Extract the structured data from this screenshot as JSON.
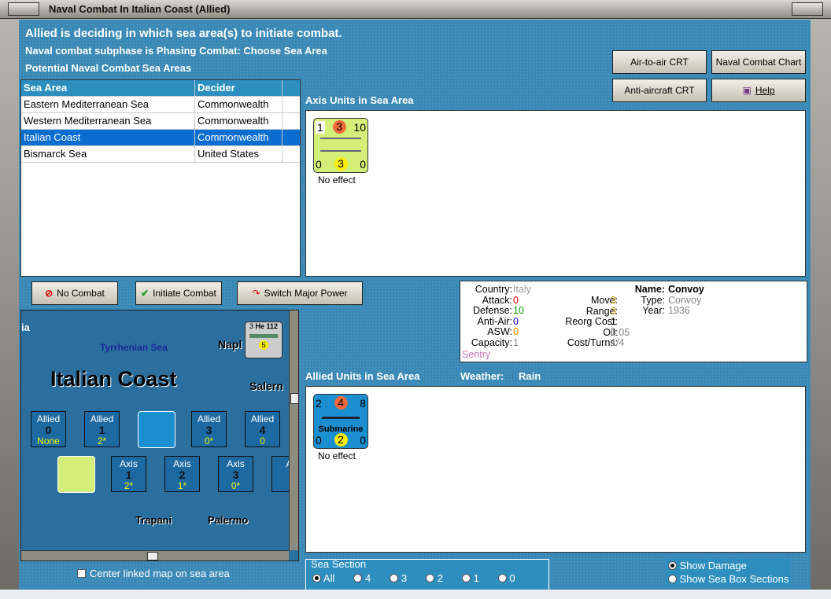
{
  "window": {
    "title": "Naval Combat In Italian Coast (Allied)"
  },
  "header": {
    "line1": "Allied is deciding in which sea area(s) to initiate combat.",
    "line2": "Naval combat subphase is Phasing Combat: Choose Sea Area",
    "line3": "Potential Naval Combat Sea Areas"
  },
  "buttons": {
    "air_crt": "Air-to-air CRT",
    "naval_chart": "Naval Combat Chart",
    "aa_crt": "Anti-aircraft CRT",
    "help": "Help",
    "no_combat": "No Combat",
    "initiate": "Initiate Combat",
    "switch": "Switch Major Power"
  },
  "table": {
    "headers": [
      "Sea Area",
      "Decider"
    ],
    "rows": [
      [
        "Eastern Mediterranean Sea",
        "Commonwealth"
      ],
      [
        "Western Mediterranean Sea",
        "Commonwealth"
      ],
      [
        "Italian Coast",
        "Commonwealth"
      ],
      [
        "Bismarck Sea",
        "United States"
      ]
    ],
    "selected": 2
  },
  "axis": {
    "label": "Axis Units in Sea Area",
    "unit": {
      "tl": "1",
      "tm": "3",
      "tr": "10",
      "bl": "0",
      "bm": "3",
      "br": "0",
      "status": "No effect"
    }
  },
  "allied": {
    "label": "Allied Units in Sea Area",
    "weather_label": "Weather:",
    "weather": "Rain",
    "unit": {
      "tl": "2",
      "tm": "4",
      "tr": "8",
      "name": "Submarine",
      "bl": "0",
      "bm": "2",
      "br": "0",
      "status": "No effect"
    }
  },
  "info": {
    "country_l": "Country:",
    "country": "Italy",
    "attack_l": "Attack:",
    "attack": "0",
    "defense_l": "Defense:",
    "defense": "10",
    "aa_l": "Anti-Air:",
    "aa": "0",
    "asw_l": "ASW:",
    "asw": "0",
    "capacity_l": "Capacity:",
    "capacity": "1",
    "sentry": "Sentry",
    "name_l": "Name:",
    "name": "Convoy",
    "move_l": "Move:",
    "move": "3",
    "type_l": "Type:",
    "type": "Convoy",
    "range_l": "Range:",
    "range": "3",
    "year_l": "Year:",
    "year": "1936",
    "reorg_l": "Reorg Cost:",
    "reorg": "1",
    "oil_l": "Oil:",
    "oil": "0.05",
    "cost_l": "Cost/Turns:",
    "cost": "1/4"
  },
  "map": {
    "title": "Italian Coast",
    "sea": "Tyrrhenian Sea",
    "cities": [
      "Napl",
      "Salern",
      "Trapani",
      "Palermo",
      "ia"
    ],
    "air_unit": {
      "a": "3",
      "name": "He 112",
      "b": "5"
    },
    "allied_boxes": [
      {
        "label": "Allied",
        "n": "0",
        "v": "None"
      },
      {
        "label": "Allied",
        "n": "1",
        "v": "2*"
      },
      {
        "label": "Allied",
        "n": "3",
        "v": "0*"
      },
      {
        "label": "Allied",
        "n": "4",
        "v": "0"
      }
    ],
    "axis_boxes": [
      {
        "label": "Axis",
        "n": "1",
        "v": "2*"
      },
      {
        "label": "Axis",
        "n": "2",
        "v": "1*"
      },
      {
        "label": "Axis",
        "n": "3",
        "v": "0*"
      },
      {
        "label": "A",
        "n": "",
        "v": ""
      }
    ]
  },
  "center_map": "Center linked map on sea area",
  "sea_section": {
    "label": "Sea Section",
    "options": [
      "All",
      "4",
      "3",
      "2",
      "1",
      "0"
    ],
    "selected": "All"
  },
  "options": {
    "show_damage": "Show Damage",
    "show_sections": "Show Sea Box Sections"
  }
}
